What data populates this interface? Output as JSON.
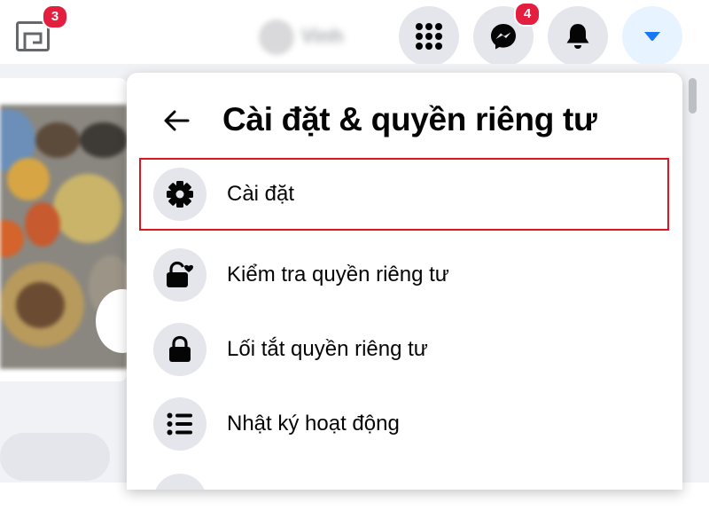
{
  "topbar": {
    "gaming_badge": "3",
    "profile_name": "Vinh",
    "menu_icon": "grid-menu-icon",
    "messenger_badge": "4",
    "notification_icon": "bell-icon",
    "account_icon": "caret-down-icon"
  },
  "panel": {
    "title": "Cài đặt & quyền riêng tư",
    "back_icon": "arrow-left-icon",
    "items": [
      {
        "label": "Cài đặt",
        "icon": "gear-icon",
        "highlighted": true
      },
      {
        "label": "Kiểm tra quyền riêng tư",
        "icon": "lock-heart-icon"
      },
      {
        "label": "Lối tắt quyền riêng tư",
        "icon": "lock-icon"
      },
      {
        "label": "Nhật ký hoạt động",
        "icon": "list-icon"
      }
    ]
  },
  "colors": {
    "accent": "#1877f2",
    "badge": "#e41e3f",
    "highlight_border": "#e0141e",
    "icon_bg": "#e4e6eb"
  }
}
